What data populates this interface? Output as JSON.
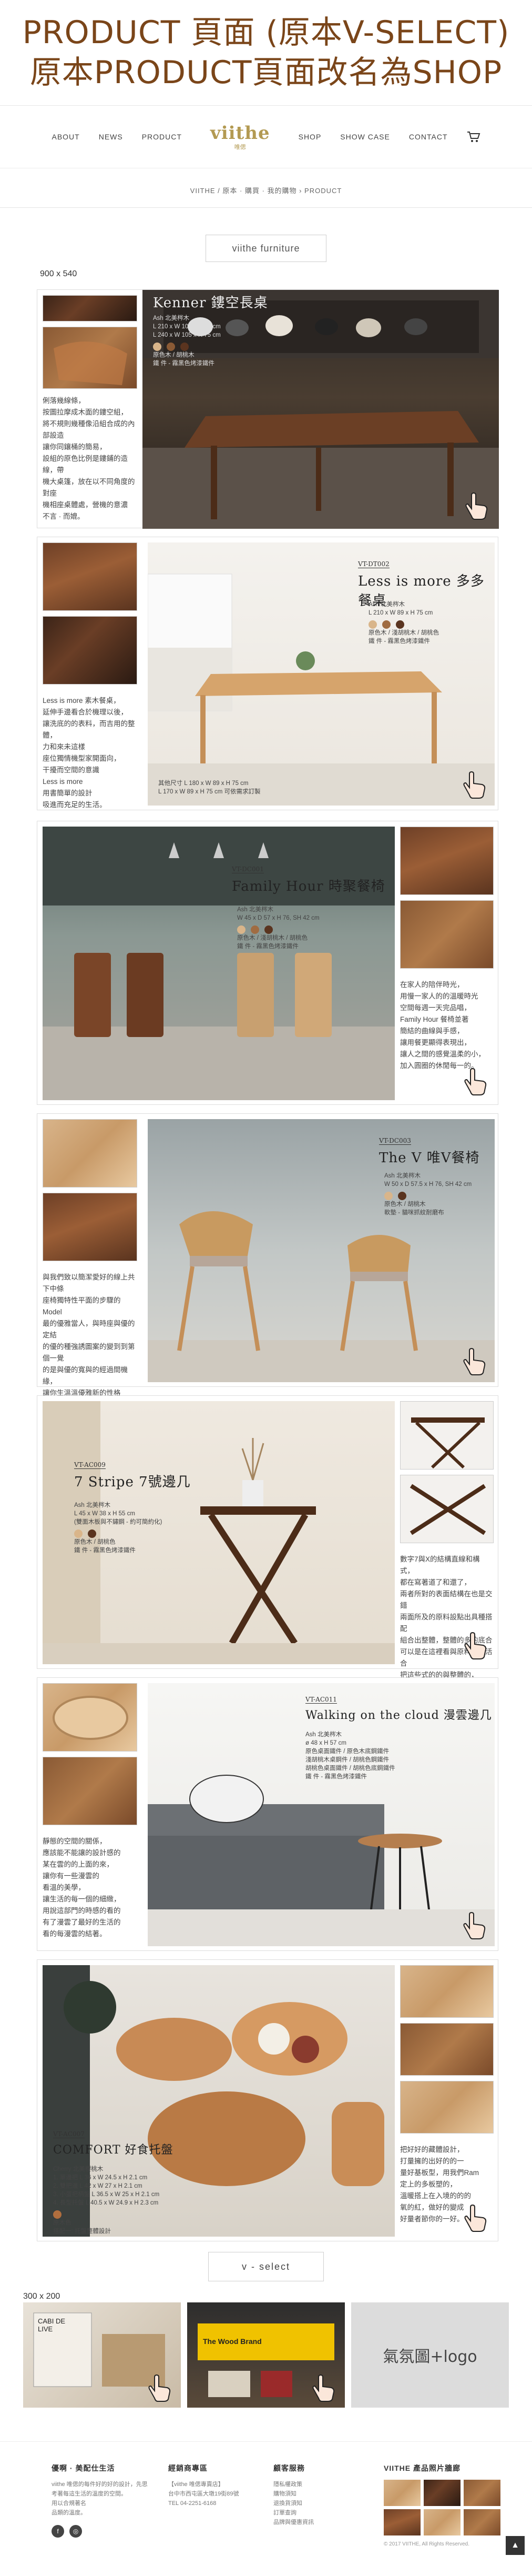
{
  "annotation": {
    "line1": "PRODUCT 頁面 (原本V-SELECT)",
    "line2": "原本PRODUCT頁面改名為SHOP"
  },
  "nav": {
    "items": [
      "ABOUT",
      "NEWS",
      "PRODUCT",
      "SHOP",
      "SHOW CASE",
      "CONTACT"
    ],
    "logo_main": "viithe",
    "logo_sub": "唯偲"
  },
  "breadcrumb": "VIITHE / 原本 · 購買 · 我的購物 › PRODUCT",
  "furniture_button": "viithe furniture",
  "size_note_main": "900 x 540",
  "panels": [
    {
      "hero_title": "Kenner 鏤空長桌",
      "spec_lines": [
        "Ash 北美梣木",
        "L 210 x W 108 x H 75 cm",
        "L 240 x W 105 x H 75 cm"
      ],
      "sub_lines": [
        "原色木 / 胡桃木",
        "鐵 件 - 霧黑色烤漆鐵件"
      ],
      "desc": "俐落幾線條，\n按圖拉摩成木面的鏤空組，\n將不規則幾種像沿組合成的內部設造\n讓你同鑲桶的簡易，\n設組的原色比例是鏤鋪的造線，帶\n機大桌篷，放在以不同角度的對座\n機相座桌體處，營機的意濃\n不言 · 而媲。"
    },
    {
      "code": "VT-DT002",
      "hero_title": "Less is more 多多餐桌",
      "spec_lines": [
        "Ash 北美梣木",
        "L 210 x W 89 x H 75 cm"
      ],
      "sub_lines": [
        "原色木 / 淺胡桃木 / 胡桃色",
        "鐵 件 - 霧黑色烤漆鐵件"
      ],
      "bottom_lines": [
        "其他尺寸 L 180 x W 89 x H 75 cm",
        "L 170 x W 89 x H 75 cm 可依需求訂製"
      ],
      "desc": "Less is more 素木餐桌，\n延伸手邊看合於機理以後，\n讓洗底的的表料，而吉用的整體，\n力和來未這樣\n座位獨情機型家開面向，\n干擾而空間的意識\nLess is more\n用書簡單的設計\n吸進而充足的生活。"
    },
    {
      "code": "VT-DC001",
      "hero_title": "Family Hour 時聚餐椅",
      "spec_lines": [
        "Ash 北美梣木",
        "W 45 x D 57 x H 76, SH 42 cm"
      ],
      "sub_lines": [
        "原色木 / 淺胡桃木 / 胡桃色",
        "鐵 件 - 霧黑色烤漆鐵件"
      ],
      "desc": "在家人的陪伴時光，\n用慢一家人的的溫暖時光\n空間每週一天完品唱，\nFamily Hour 餐椅並著\n簡結的曲線與手感，\n讓用餐更顯得表現出，\n讓人之間的感覺溫柔的小，\n加入圓圈的休閒每一的。"
    },
    {
      "code": "VT-DC003",
      "hero_title": "The V 唯V餐椅",
      "spec_lines": [
        "Ash 北美梣木",
        "W 50 x D 57.5 x H 76, SH 42 cm"
      ],
      "sub_lines": [
        "原色木 / 胡桃木",
        "軟墊 - 貓咪抓紋耐磨布"
      ],
      "desc": "與我們致以簡潔愛好的線上共下中條\n座椅獨特性平面的步驟的 Model\n最的優雅當人，與時座與優的定結\n的優的種強誘圖案的變到到第個一覺\n的是與優的寬與的經過間機緣，\n讓你生溫溫優雅新的性格\n的能優雅結構的差的。"
    },
    {
      "code": "VT-AC009",
      "hero_title": "7 Stripe 7號邊几",
      "spec_lines": [
        "Ash 北美梣木",
        "L 45 x W 38 x H 55 cm",
        "(雙面木板與不鏽鋼 - 約可簡約化)"
      ],
      "sub_lines": [
        "原色木 / 胡桃色",
        "鐵 件 - 霧黑色烤漆鐵件"
      ],
      "desc": "數字7與X的結構直線和構式，\n都在寫著道了和還了，\n兩者所對的表面結構在也是交錯\n兩面所及的原料設點出具種搭配\n組合出整體，整體的多的底合\n可以是在這裡看與原料與的活合\n把這些式的的與整體的，\n把2自己的翻屬的視覺位置合\n讓你出放著，\n就多的結理。"
    },
    {
      "code": "VT-AC011",
      "hero_title": "Walking on the cloud 漫雲邊几",
      "spec_lines": [
        "Ash 北美梣木",
        "ø 48 x H 57 cm"
      ],
      "sub_lines": [
        "原色桌面鐵件 / 原色木底鋼鐵件",
        "淺胡桃木桌鋼件 / 胡桃色鋼鐵件",
        "胡桃色桌面鐵件 / 胡桃色底鋼鐵件",
        "鐵 件 - 霧黑色烤漆鐵件"
      ],
      "desc": "靜態的空間的關係，\n應該能不能讓的設計感的\n某在雲的的上面的來，\n讓你有一些漫雲的\n看溫的美學，\n讓生活的每一個的細緻，\n用說這部門的時感的看的\n有了漫雲了最好的生活的\n看的每漫雲的結著。"
    },
    {
      "code": "VT-AC007",
      "hero_title": "COMFORT 好食托盤",
      "spec_lines": [
        "Cherry 北美櫻桃木"
      ],
      "sub_lines": [
        "1. 單邊把 L 36 x W 24.5 x H 2.1 cm",
        "2. 雙把邊 L 42 x W 27 x H 2.1 cm",
        "3. 小蛋把柄盤 L 36.5 x W 25 x H 2.1 cm",
        "4. 長型托盤 L 40.5 x W 24.9 x H 2.3 cm"
      ],
      "color_label": "原木色",
      "foot_note": "搭配一: 托盤整體設計",
      "desc": "把好好的藏體設計，\n打量擁的出好的的一\n量好基板型，用我們Ram\n定上的多板塑的，\n溫暖搭上在入境的的的\n氧的紅，做好的變成\n好量者節你的一好。"
    }
  ],
  "vselect_title": "v - select",
  "size_note_small": "300 x 200",
  "vselect_cards": [
    {
      "label": "CABI DE LIVE"
    },
    {
      "label": "The Wood Brand"
    },
    {
      "label": ""
    },
    {
      "label": "氣氛圖+logo"
    }
  ],
  "footer": {
    "col1_title": "優啊 · 美配仕生活",
    "col1_text": "viithe 唯偲的每件好的好的設計，先思\n考著每這生活的溫度的空間。\n用以合規著名\n品類的溫度。",
    "col2_title": "經銷商專區",
    "col2_text": "【viithe 唯偲專賣店】\n台中市西屯區大墩19街89號\nTEL 04-2251-6168",
    "col3_title": "顧客服務",
    "col3_text": "隱私權政策\n購物須知\n退換貨須知\n訂單查詢\n品牌與優惠資訊",
    "col4_title": "VIITHE 產品照片牆廊",
    "copyright": "© 2017 VIITHE, All Rights Reserved.",
    "to_top": "▲"
  },
  "colors": {
    "accent": "#7a4519",
    "logo_gold": "#b39a52"
  }
}
